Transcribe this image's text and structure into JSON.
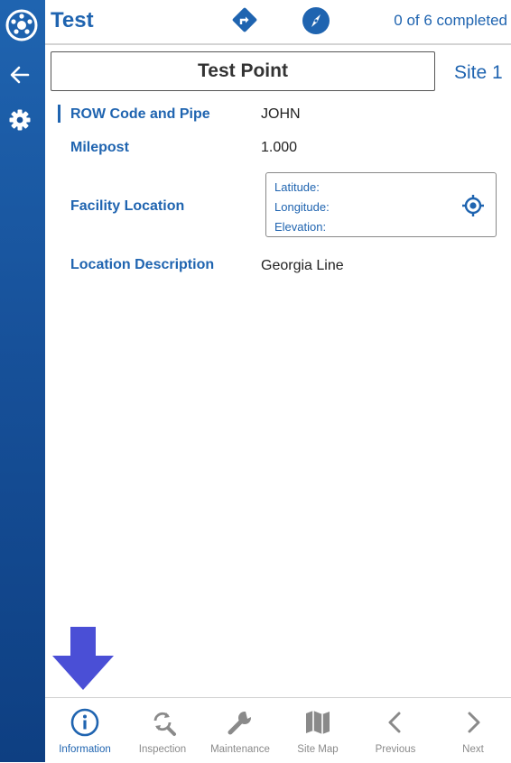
{
  "header": {
    "app_title": "Test",
    "progress_text": "0 of 6 completed"
  },
  "record": {
    "title": "Test Point",
    "site_label": "Site 1"
  },
  "fields": [
    {
      "label": "ROW Code and Pipe",
      "value": "JOHN"
    },
    {
      "label": "Milepost",
      "value": "1.000"
    },
    {
      "label": "Facility Location",
      "value": ""
    },
    {
      "label": "Location Description",
      "value": "Georgia Line"
    }
  ],
  "location": {
    "latitude_label": "Latitude:",
    "longitude_label": "Longitude:",
    "elevation_label": "Elevation:"
  },
  "bottom_nav": [
    {
      "label": "Information",
      "icon": "info-icon",
      "active": true
    },
    {
      "label": "Inspection",
      "icon": "inspection-icon",
      "active": false
    },
    {
      "label": "Maintenance",
      "icon": "wrench-icon",
      "active": false
    },
    {
      "label": "Site Map",
      "icon": "map-icon",
      "active": false
    },
    {
      "label": "Previous",
      "icon": "chevron-left-icon",
      "active": false
    },
    {
      "label": "Next",
      "icon": "chevron-right-icon",
      "active": false
    }
  ],
  "colors": {
    "brand_blue": "#1f64b0",
    "indicator_arrow": "#4a4fd6",
    "inactive_gray": "#8a8a8a"
  }
}
